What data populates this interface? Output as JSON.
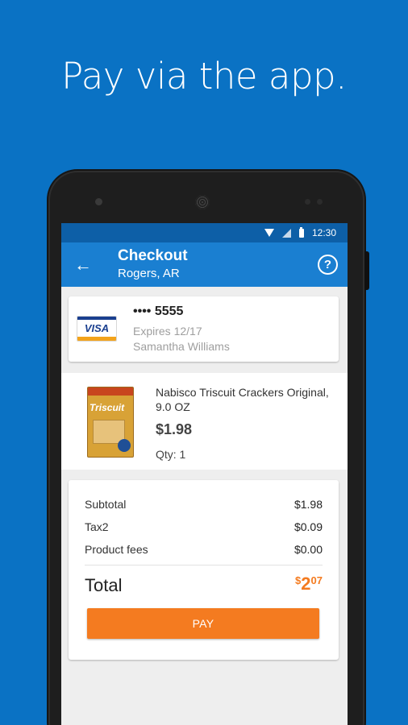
{
  "headline": "Pay via the app.",
  "status_bar": {
    "time": "12:30",
    "icons": [
      "wifi-icon",
      "signal-icon",
      "battery-icon"
    ]
  },
  "app_bar": {
    "title": "Checkout",
    "subtitle": "Rogers, AR",
    "back_icon": "←",
    "help_icon": "?"
  },
  "payment_card": {
    "brand": "VISA",
    "number": "•••• 5555",
    "expires": "Expires 12/17",
    "name": "Samantha Williams"
  },
  "item": {
    "name": "Nabisco Triscuit Crackers Original, 9.0 OZ",
    "price": "$1.98",
    "qty": "Qty: 1",
    "image_brand": "Triscuit"
  },
  "summary": {
    "rows": [
      {
        "label": "Subtotal",
        "amount": "$1.98"
      },
      {
        "label": "Tax2",
        "amount": "$0.09"
      },
      {
        "label": "Product fees",
        "amount": "$0.00"
      }
    ],
    "total_label": "Total",
    "total_currency": "$",
    "total_dollars": "2",
    "total_cents": "07",
    "pay_label": "PAY"
  },
  "colors": {
    "background": "#0a72c4",
    "app_bar": "#1a7fd1",
    "accent": "#f47b20"
  }
}
